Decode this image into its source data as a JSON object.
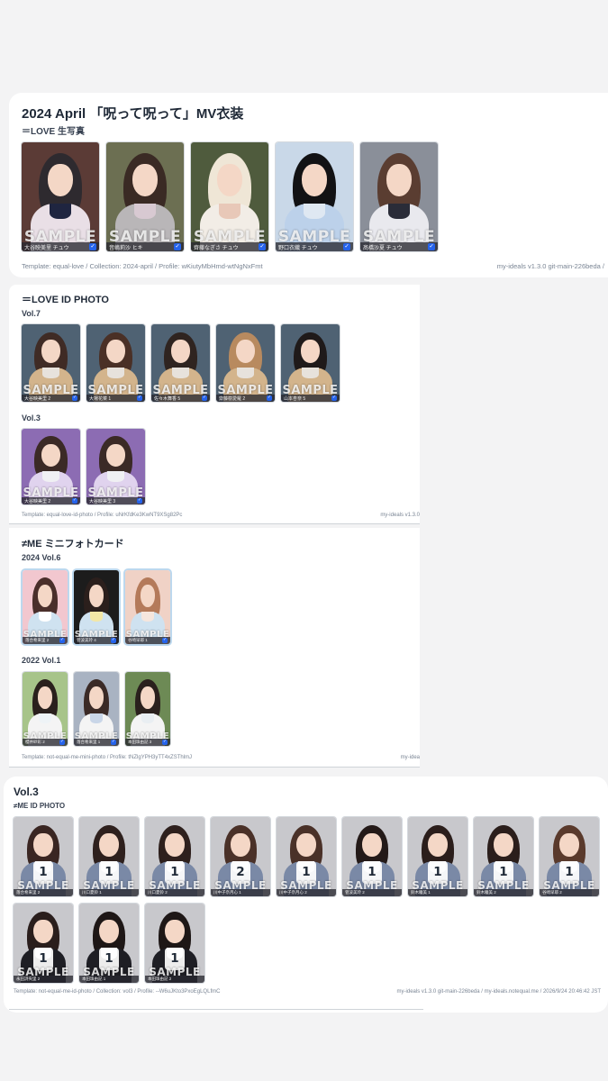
{
  "colors": {
    "page_bg": "#f3f3f4",
    "card_bg": "#ffffff",
    "check_blue": "#2563eb"
  },
  "sections": [
    {
      "title": "2024 April 「呪って呪って」MV衣装",
      "subtitle": "＝LOVE 生写真",
      "footer_left": "Template: equal-love / Collection: 2024-april / Profile: wKiutyMbHmd-wtNgNxFmt",
      "footer_right": "my-ideals v1.3.0 git-main-226beda /",
      "photos": [
        {
          "name": "大谷映美里 チュウ",
          "sample": "SAMPLE",
          "checked": "✓",
          "palette": [
            "#5b3b36",
            "#2e2a2f",
            "#1f2540",
            "#e9dfe6"
          ]
        },
        {
          "name": "音嶋莉沙 ヒキ",
          "sample": "SAMPLE",
          "checked": "✓",
          "palette": [
            "#6c6f52",
            "#3a2a24",
            "#d8c9d2",
            "#b9b6b8"
          ]
        },
        {
          "name": "齊藤なぎさ チュウ",
          "sample": "SAMPLE",
          "checked": "✓",
          "palette": [
            "#4f5b3d",
            "#efe6d6",
            "#e8c8b8",
            "#f2ede6"
          ]
        },
        {
          "name": "野口衣織 チュウ",
          "sample": "SAMPLE",
          "checked": "✓",
          "palette": [
            "#c9d8e8",
            "#121214",
            "#dfe8f2",
            "#bcd1ea"
          ]
        },
        {
          "name": "髙橋沙夏 チュウ",
          "sample": "SAMPLE",
          "checked": "✓",
          "palette": [
            "#8a8f99",
            "#5a3d31",
            "#2a2c38",
            "#e9e9ee"
          ]
        }
      ]
    },
    {
      "title": "＝LOVE ID PHOTO",
      "groups": [
        {
          "label": "Vol.7",
          "photos": [
            {
              "name": "大谷映美里 2",
              "sample": "SAMPLE",
              "checked": "✓",
              "palette": [
                "#4f6273",
                "#3f2b25",
                "#e7e2dc",
                "#d3b48c"
              ]
            },
            {
              "name": "大場花菜 1",
              "sample": "SAMPLE",
              "checked": "✓",
              "palette": [
                "#4f6273",
                "#4a3026",
                "#e7e2dc",
                "#d3b48c"
              ]
            },
            {
              "name": "佐々木舞香 5",
              "sample": "SAMPLE",
              "checked": "✓",
              "palette": [
                "#4f6273",
                "#2f2420",
                "#e7e2dc",
                "#d3b48c"
              ]
            },
            {
              "name": "齋藤樹愛羅 2",
              "sample": "SAMPLE",
              "checked": "✓",
              "palette": [
                "#4f6273",
                "#b88a5f",
                "#e7e2dc",
                "#d3b48c"
              ]
            },
            {
              "name": "山本杏奈 5",
              "sample": "SAMPLE",
              "checked": "✓",
              "palette": [
                "#4f6273",
                "#1f1a1a",
                "#e7e2dc",
                "#d3b48c"
              ]
            }
          ]
        },
        {
          "label": "Vol.3",
          "photos": [
            {
              "name": "大谷映美里 2",
              "sample": "SAMPLE",
              "checked": "✓",
              "palette": [
                "#8c6cb3",
                "#3b2a26",
                "#f0f0f3",
                "#e0d3ee"
              ]
            },
            {
              "name": "大谷映美里 3",
              "sample": "SAMPLE",
              "checked": "✓",
              "palette": [
                "#8c6cb3",
                "#3b2a26",
                "#f0f0f3",
                "#e0d3ee"
              ]
            }
          ]
        }
      ],
      "footer_left": "Template: equal-love-id-photo / Profile: uNrKfdKe3KwNT9XSg82Pc",
      "footer_right": "my-ideals v1.3.0"
    },
    {
      "title": "≠ME ミニフォトカード",
      "groups": [
        {
          "label": "2024 Vol.6",
          "photos": [
            {
              "name": "落合希来里 2",
              "sample": "SAMPLE",
              "checked": "✓",
              "palette": [
                "#f2c7cf",
                "#4a2f2b",
                "#ffffff",
                "#cfe2f0"
              ]
            },
            {
              "name": "菅波美玲 4",
              "sample": "SAMPLE",
              "checked": "✓",
              "palette": [
                "#1c1c1c",
                "#2b1f1c",
                "#f3e7a6",
                "#cfe2f0"
              ]
            },
            {
              "name": "谷崎早耶 1",
              "sample": "SAMPLE",
              "checked": "✓",
              "palette": [
                "#f0d2c6",
                "#b47a5a",
                "#f6e6dd",
                "#cfe2f0"
              ]
            }
          ]
        },
        {
          "label": "2022 Vol.1",
          "photos": [
            {
              "name": "櫻井紗彩 2",
              "sample": "SAMPLE",
              "checked": "✓",
              "palette": [
                "#a7c48a",
                "#2a201d",
                "#eef3f6",
                "#f4f4f4"
              ]
            },
            {
              "name": "落合希来里 1",
              "sample": "SAMPLE",
              "checked": "✓",
              "palette": [
                "#a9b3c2",
                "#3b2a26",
                "#c9d6e8",
                "#f4f4f4"
              ]
            },
            {
              "name": "本田珠由記 3",
              "sample": "SAMPLE",
              "checked": "✓",
              "palette": [
                "#6d8a55",
                "#2a201d",
                "#e9eef2",
                "#f4f4f4"
              ]
            }
          ]
        }
      ],
      "footer_left": "Template: not-equal-me-mini-photo / Profile: tNZlgYPH3yTT4xZSThlmJ",
      "footer_right": "my-idea"
    },
    {
      "title": "Vol.3",
      "subtitle": "≠ME ID PHOTO",
      "photos": [
        {
          "name": "落合希来里 2",
          "count": "1",
          "sample": "SAMPLE",
          "palette": [
            "#c8c8cc",
            "#3a2622",
            "#e6e6ec",
            "#7a89a6"
          ]
        },
        {
          "name": "川口夏鈴 1",
          "count": "1",
          "sample": "SAMPLE",
          "palette": [
            "#c8c8cc",
            "#2e201d",
            "#e6e6ec",
            "#7a89a6"
          ]
        },
        {
          "name": "川口夏鈴 2",
          "count": "1",
          "sample": "SAMPLE",
          "palette": [
            "#c8c8cc",
            "#2e201d",
            "#e6e6ec",
            "#7a89a6"
          ]
        },
        {
          "name": "川中子奈月心 1",
          "count": "2",
          "sample": "SAMPLE",
          "palette": [
            "#c8c8cc",
            "#4a3128",
            "#e6e6ec",
            "#7a89a6"
          ]
        },
        {
          "name": "川中子奈月心 2",
          "count": "1",
          "sample": "SAMPLE",
          "palette": [
            "#c8c8cc",
            "#4a3128",
            "#e6e6ec",
            "#7a89a6"
          ]
        },
        {
          "name": "菅波美玲 2",
          "count": "1",
          "sample": "SAMPLE",
          "palette": [
            "#c8c8cc",
            "#241a18",
            "#e6e6ec",
            "#7a89a6"
          ]
        },
        {
          "name": "鈴木瞳美 1",
          "count": "1",
          "sample": "SAMPLE",
          "palette": [
            "#c8c8cc",
            "#2b1e1b",
            "#e6e6ec",
            "#7a89a6"
          ]
        },
        {
          "name": "鈴木瞳美 2",
          "count": "1",
          "sample": "SAMPLE",
          "palette": [
            "#c8c8cc",
            "#2b1e1b",
            "#e6e6ec",
            "#7a89a6"
          ]
        },
        {
          "name": "谷崎早耶 2",
          "count": "1",
          "sample": "SAMPLE",
          "palette": [
            "#c8c8cc",
            "#5a3a2c",
            "#e6e6ec",
            "#7a89a6"
          ]
        },
        {
          "name": "永田詩央里 2",
          "count": "1",
          "sample": "SAMPLE",
          "palette": [
            "#c8c8cc",
            "#2a1e1c",
            "#e6e6ec",
            "#1e1e24"
          ]
        },
        {
          "name": "本田珠由記 1",
          "count": "1",
          "sample": "SAMPLE",
          "palette": [
            "#c8c8cc",
            "#1e1716",
            "#e6e6ec",
            "#1e1e24"
          ]
        },
        {
          "name": "本田珠由記 2",
          "count": "1",
          "sample": "SAMPLE",
          "palette": [
            "#c8c8cc",
            "#1e1716",
            "#e6e6ec",
            "#1e1e24"
          ]
        }
      ],
      "footer_left": "Template: not-equal-me-id-photo / Collection: vol3 / Profile: --W6uJKto3PxoEgLQLfmC",
      "footer_right": "my-ideals v1.3.0 git-main-226beda / my-ideals.notequal.me / 2026/9/24 20:46:42 JST"
    }
  ]
}
